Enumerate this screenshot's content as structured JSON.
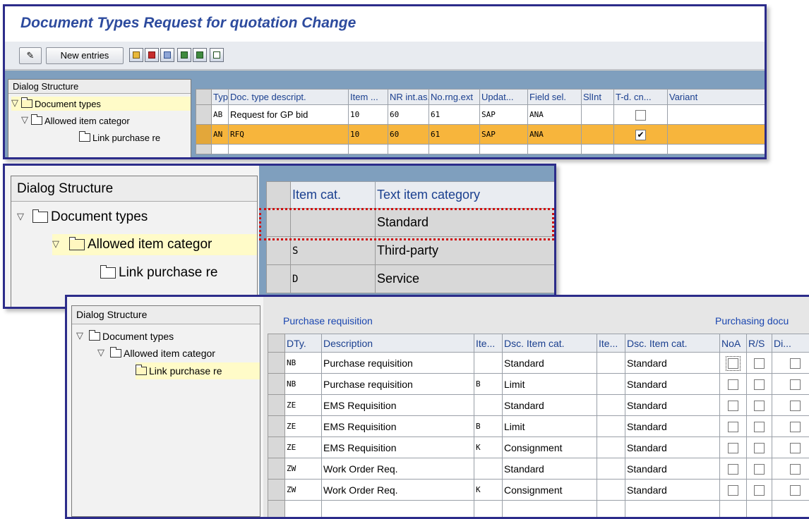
{
  "window": {
    "title": "Document Types Request for quotation Change"
  },
  "toolbar": {
    "new_entries_label": "New entries"
  },
  "dialog_structure": {
    "title": "Dialog Structure",
    "items": [
      "Document types",
      "Allowed item categor",
      "Link purchase re"
    ],
    "panel3_items": [
      "Document types",
      "Allowed item categor",
      "Link purchase re"
    ]
  },
  "doc_types_table": {
    "columns": [
      "Type",
      "Doc. type descript.",
      "Item ...",
      "NR int.as.",
      "No.rng.ext",
      "Updat...",
      "Field sel.",
      "SlInt",
      "T-d. cn...",
      "Variant"
    ],
    "rows": [
      {
        "type": "AB",
        "desc": "Request for GP bid",
        "item": "10",
        "nr_int": "60",
        "nr_ext": "61",
        "update": "SAP",
        "field_sel": "ANA",
        "slint": "",
        "td_checked": false,
        "variant": "",
        "selected": false
      },
      {
        "type": "AN",
        "desc": "RFQ",
        "item": "10",
        "nr_int": "60",
        "nr_ext": "61",
        "update": "SAP",
        "field_sel": "ANA",
        "slint": "",
        "td_checked": true,
        "variant": "",
        "selected": true
      }
    ]
  },
  "item_cat_table": {
    "columns": [
      "Item cat.",
      "Text item category"
    ],
    "rows": [
      {
        "cat": "",
        "text": "Standard"
      },
      {
        "cat": "S",
        "text": "Third-party"
      },
      {
        "cat": "D",
        "text": "Service"
      }
    ]
  },
  "link_table": {
    "section_left": "Purchase requisition",
    "section_right": "Purchasing docu",
    "columns": [
      "DTy.",
      "Description",
      "Ite...",
      "Dsc. Item cat.",
      "Ite...",
      "Dsc. Item cat.",
      "NoA",
      "R/S",
      "Di..."
    ],
    "rows": [
      {
        "dty": "NB",
        "desc": "Purchase requisition",
        "ite1": "",
        "dsc1": "Standard",
        "ite2": "",
        "dsc2": "Standard"
      },
      {
        "dty": "NB",
        "desc": "Purchase requisition",
        "ite1": "B",
        "dsc1": "Limit",
        "ite2": "",
        "dsc2": "Standard"
      },
      {
        "dty": "ZE",
        "desc": "EMS Requisition",
        "ite1": "",
        "dsc1": "Standard",
        "ite2": "",
        "dsc2": "Standard"
      },
      {
        "dty": "ZE",
        "desc": "EMS Requisition",
        "ite1": "B",
        "dsc1": "Limit",
        "ite2": "",
        "dsc2": "Standard"
      },
      {
        "dty": "ZE",
        "desc": "EMS Requisition",
        "ite1": "K",
        "dsc1": "Consignment",
        "ite2": "",
        "dsc2": "Standard"
      },
      {
        "dty": "ZW",
        "desc": "Work Order Req.",
        "ite1": "",
        "dsc1": "Standard",
        "ite2": "",
        "dsc2": "Standard"
      },
      {
        "dty": "ZW",
        "desc": "Work Order Req.",
        "ite1": "K",
        "dsc1": "Consignment",
        "ite2": "",
        "dsc2": "Standard"
      }
    ]
  },
  "colors": {
    "title_blue": "#2d4b9e",
    "frame_blue": "#2c2c8a",
    "selection_orange": "#f7b53c",
    "highlight_box_red": "#d01010"
  }
}
